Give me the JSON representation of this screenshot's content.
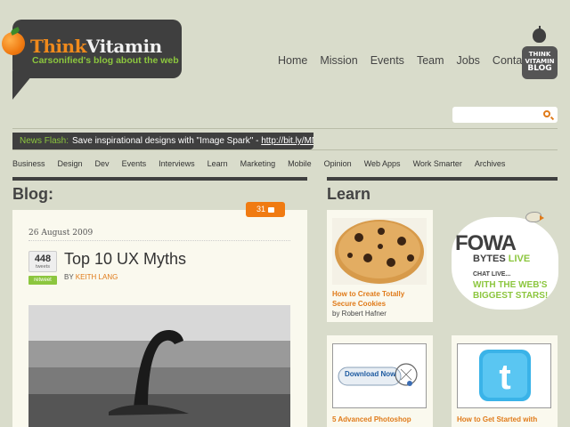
{
  "brand": {
    "logo_think": "Think",
    "logo_vitamin": "Vitamin",
    "tagline": "Carsonified's blog about the web",
    "blog_badge_lines": [
      "THINK",
      "VITAMIN",
      "BLOG"
    ]
  },
  "topnav": [
    {
      "label": "Home"
    },
    {
      "label": "Mission"
    },
    {
      "label": "Events"
    },
    {
      "label": "Team"
    },
    {
      "label": "Jobs"
    },
    {
      "label": "Contact"
    }
  ],
  "search": {
    "placeholder": "",
    "value": ""
  },
  "newsflash": {
    "label": "News Flash:",
    "text": "Save inspirational designs with \"Image Spark\" - ",
    "link": "http://bit.ly/MNDgj"
  },
  "categories": [
    {
      "label": "Business"
    },
    {
      "label": "Design"
    },
    {
      "label": "Dev"
    },
    {
      "label": "Events"
    },
    {
      "label": "Interviews"
    },
    {
      "label": "Learn"
    },
    {
      "label": "Marketing"
    },
    {
      "label": "Mobile"
    },
    {
      "label": "Opinion"
    },
    {
      "label": "Web Apps"
    },
    {
      "label": "Work Smarter"
    },
    {
      "label": "Archives"
    }
  ],
  "blog": {
    "heading": "Blog:",
    "comment_count": "31",
    "post": {
      "date": "26 August 2009",
      "tweets": "448",
      "tweets_label": "tweets",
      "retweet_label": "retweet",
      "title": "Top 10 UX Myths",
      "by_label": "BY",
      "author": "KEITH LANG"
    }
  },
  "learn": {
    "heading": "Learn",
    "cards": [
      {
        "title": "How to Create Totally Secure Cookies",
        "author": "by Robert Hafner"
      },
      {
        "title": "5 Advanced Photoshop",
        "author": ""
      },
      {
        "title": "How to Get Started with",
        "author": ""
      }
    ],
    "download_label": "Download Now"
  },
  "promo": {
    "fowa": "FOWA",
    "bytes": "BYTES",
    "live": "LIVE",
    "chat": "CHAT LIVE...",
    "green_line1": "WITH THE WEB'S",
    "green_line2": "BIGGEST STARS!"
  },
  "colors": {
    "background": "#d9dccb",
    "dark": "#3f3f3f",
    "accent_orange": "#f07b12",
    "accent_green": "#8cc63e"
  }
}
